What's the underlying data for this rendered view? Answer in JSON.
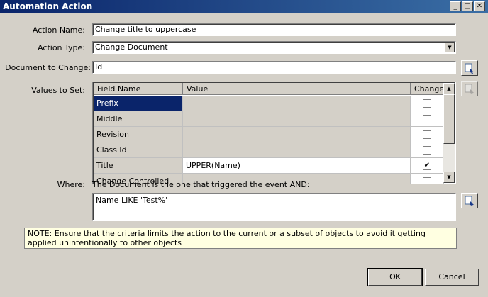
{
  "window": {
    "title": "Automation Action",
    "controls": {
      "minimize": "_",
      "maximize": "□",
      "close": "✕"
    }
  },
  "form": {
    "action_name_label": "Action Name:",
    "action_name_value": "Change title to uppercase",
    "action_type_label": "Action Type:",
    "action_type_value": "Change Document",
    "document_label": "Document to Change:",
    "document_value": "Id",
    "values_label": "Values to Set:"
  },
  "grid": {
    "headers": {
      "field": "Field Name",
      "value": "Value",
      "change": "Change"
    },
    "rows": [
      {
        "field": "Prefix",
        "value": "",
        "change": false,
        "selected": true
      },
      {
        "field": "Middle",
        "value": "",
        "change": false
      },
      {
        "field": "Revision",
        "value": "",
        "change": false
      },
      {
        "field": "Class Id",
        "value": "",
        "change": false
      },
      {
        "field": "Title",
        "value": "UPPER(Name)",
        "change": true,
        "editable": true
      },
      {
        "field": "Change Controlled",
        "value": "",
        "change": false
      }
    ],
    "scroll_up": "▲",
    "scroll_down": "▼"
  },
  "where": {
    "label": "Where:",
    "description": "The Document is the one that triggered the event AND:",
    "criteria": "Name LIKE 'Test%'"
  },
  "note": "NOTE:  Ensure that the criteria limits the action to the current or a subset of objects to avoid it getting applied unintentionally to other objects",
  "buttons": {
    "ok": "OK",
    "cancel": "Cancel"
  },
  "icons": {
    "picker": "picker-icon",
    "dropdown": "▼"
  },
  "colors": {
    "title_start": "#0a246a",
    "title_end": "#3a6ea5",
    "selection": "#0a246a",
    "note_bg": "#ffffe1"
  }
}
